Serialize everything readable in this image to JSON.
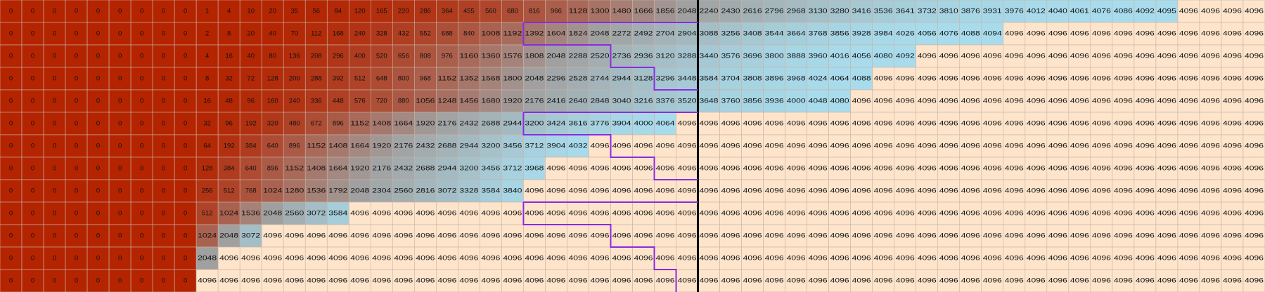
{
  "chart_data": {
    "type": "heatmap",
    "title": "",
    "xlabel": "",
    "ylabel": "",
    "n_rows": 13,
    "n_cols": 58,
    "cap_value": 4096,
    "colors": {
      "zero": "#b42400",
      "low": "#b06a58",
      "mid": "#a0a0a0",
      "high": "#a8dced",
      "capped": "#fde4cb",
      "gridline": "#c9b3a4",
      "divider": "#000000",
      "boundary": "#8b2be2"
    },
    "row_templates": [
      {
        "zeros": 9,
        "values": [
          1,
          4,
          10,
          20,
          35,
          56,
          84,
          120,
          165,
          220,
          286,
          364,
          455,
          560,
          680,
          816,
          966,
          1128,
          1300,
          1480,
          1666,
          1856,
          2048,
          2240,
          2430,
          2616,
          2796,
          2968,
          3130,
          3280,
          3416,
          3536,
          3641,
          3732,
          3810,
          3876,
          3931,
          3976,
          4012,
          4040,
          4061,
          4076,
          4086,
          4092,
          4095
        ]
      },
      {
        "zeros": 9,
        "values": [
          2,
          8,
          20,
          40,
          70,
          112,
          168,
          240,
          328,
          432,
          552,
          688,
          840,
          1008,
          1192,
          1392,
          1604,
          1824,
          2048,
          2272,
          2492,
          2704,
          2904,
          3088,
          3256,
          3408,
          3544,
          3664,
          3768,
          3856,
          3928,
          3984,
          4026,
          4056,
          4076,
          4088,
          4094
        ]
      },
      {
        "zeros": 9,
        "values": [
          4,
          16,
          40,
          80,
          136,
          208,
          296,
          400,
          520,
          656,
          808,
          976,
          1160,
          1360,
          1576,
          1808,
          2048,
          2288,
          2520,
          2736,
          2936,
          3120,
          3288,
          3440,
          3576,
          3696,
          3800,
          3888,
          3960,
          4016,
          4056,
          4080,
          4092
        ]
      },
      {
        "zeros": 9,
        "values": [
          8,
          32,
          72,
          128,
          200,
          288,
          392,
          512,
          648,
          800,
          968,
          1152,
          1352,
          1568,
          1800,
          2048,
          2296,
          2528,
          2744,
          2944,
          3128,
          3296,
          3448,
          3584,
          3704,
          3808,
          3896,
          3968,
          4024,
          4064,
          4088
        ]
      },
      {
        "zeros": 9,
        "values": [
          16,
          48,
          96,
          160,
          240,
          336,
          448,
          576,
          720,
          880,
          1056,
          1248,
          1456,
          1680,
          1920,
          2176,
          2416,
          2640,
          2848,
          3040,
          3216,
          3376,
          3520,
          3648,
          3760,
          3856,
          3936,
          4000,
          4048,
          4080
        ]
      },
      {
        "zeros": 9,
        "values": [
          32,
          96,
          192,
          320,
          480,
          672,
          896,
          1152,
          1408,
          1664,
          1920,
          2176,
          2432,
          2688,
          2944,
          3200,
          3424,
          3616,
          3776,
          3904,
          4000,
          4064
        ]
      },
      {
        "zeros": 9,
        "values": [
          64,
          192,
          384,
          640,
          896,
          1152,
          1408,
          1664,
          1920,
          2176,
          2432,
          2688,
          2944,
          3200,
          3456,
          3712,
          3904,
          4032
        ]
      },
      {
        "zeros": 9,
        "values": [
          128,
          384,
          640,
          896,
          1152,
          1408,
          1664,
          1920,
          2176,
          2432,
          2688,
          2944,
          3200,
          3456,
          3712,
          3968
        ]
      },
      {
        "zeros": 9,
        "values": [
          256,
          512,
          768,
          1024,
          1280,
          1536,
          1792,
          2048,
          2304,
          2560,
          2816,
          3072,
          3328,
          3584,
          3840
        ]
      },
      {
        "zeros": 9,
        "values": [
          512,
          1024,
          1536,
          2048,
          2560,
          3072,
          3584
        ]
      },
      {
        "zeros": 9,
        "values": [
          1024,
          2048,
          3072
        ]
      },
      {
        "zeros": 9,
        "values": [
          2048
        ]
      },
      {
        "zeros": 9,
        "values": []
      }
    ],
    "divider_after_col": 31,
    "boundary_steps": [
      {
        "row": 0,
        "right_col": 23,
        "top_col": 24
      },
      {
        "row": 1,
        "left_col": 24,
        "right_col": 31
      },
      {
        "row": 2,
        "left_col": 28,
        "right_col": 31
      },
      {
        "row": 3,
        "left_col": 30,
        "right_col": 31
      },
      {
        "row": 4,
        "left_col": 24,
        "right_col": 31
      },
      {
        "row": 5,
        "left_col": 28,
        "right_col": 31
      },
      {
        "row": 6,
        "left_col": 30,
        "right_col": 31
      },
      {
        "row": 7,
        "left_col": 24,
        "right_col": 31
      },
      {
        "row": 8,
        "left_col": 28,
        "right_col": 31
      },
      {
        "row": 9,
        "left_col": 30,
        "right_col": 31
      },
      {
        "row": 10,
        "left_col": 31,
        "right_col": 31
      }
    ],
    "grid": true,
    "legend": "none"
  }
}
